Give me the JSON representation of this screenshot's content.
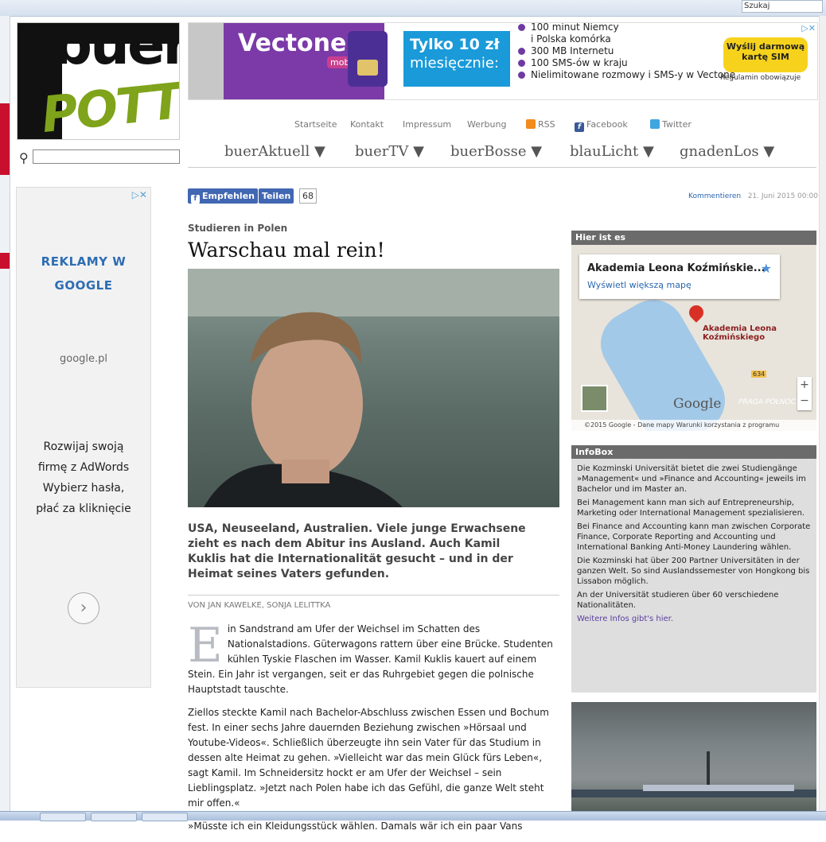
{
  "chrome": {
    "search_placeholder": "Szukaj"
  },
  "site": {
    "search_placeholder": "",
    "logo_top": "buer",
    "logo_bottom": "POTT"
  },
  "banner_ad": {
    "brand": "Vectone",
    "brand_sub": "mobile",
    "price_line1": "Tylko 10 zł",
    "price_line2": "miesięcznie:",
    "bullets": [
      "100 minut Niemcy",
      "i Polska komórka",
      "300 MB Internetu",
      "100 SMS-ów w kraju",
      "Nielimitowane rozmowy i SMS-y w Vectone"
    ],
    "cta": "Wyślij darmową kartę SIM",
    "note": "Regulamin obowiązuje",
    "brand_color": "#7b3aa8",
    "cta_color": "#f7d21c"
  },
  "utility_nav": [
    "Startseite",
    "Kontakt",
    "Impressum",
    "Werbung",
    "RSS",
    "Facebook",
    "Twitter"
  ],
  "main_nav": [
    "buerAktuell ▼",
    "buerTV ▼",
    "buerBosse ▼",
    "blauLicht ▼",
    "gnadenLos ▼"
  ],
  "share": {
    "like": "Empfehlen",
    "share": "Teilen",
    "count": "68",
    "comments": "Kommentieren",
    "date": "21. Juni 2015  00:00"
  },
  "left_ad": {
    "title_line1": "REKLAMY W",
    "title_line2": "GOOGLE",
    "domain": "google.pl",
    "copy_lines": [
      "Rozwijaj swoją",
      "firmę z AdWords",
      "Wybierz hasła,",
      "płać za kliknięcie"
    ],
    "arrow": "›"
  },
  "article": {
    "kicker": "Studieren in Polen",
    "headline": "Warschau mal rein!",
    "lead": "USA, Neuseeland, Australien. Viele junge Erwachsene zieht es nach dem Abitur ins Ausland. Auch Kamil Kuklis hat die Internationalität gesucht – und in der Heimat seines Vaters gefunden.",
    "byline": "VON JAN KAWELKE, SONJA LELITTKA",
    "dropcap": "E",
    "p1": "in Sandstrand am Ufer der Weichsel im Schatten des Nationalstadions. Güterwagons rattern über eine Brücke. Studenten kühlen Tyskie Flaschen im Wasser. Kamil Kuklis kauert auf einem Stein. Ein Jahr ist vergangen, seit er das Ruhrgebiet gegen die polnische Hauptstadt tauschte.",
    "p2": "Ziellos steckte Kamil nach Bachelor-Abschluss zwischen Essen und Bochum fest. In einer sechs Jahre dauernden Beziehung zwischen »Hörsaal und Youtube-Videos«. Schließlich überzeugte ihn sein Vater für das Studium in dessen alte Heimat zu gehen. »Vielleicht war das mein Glück fürs Leben«, sagt Kamil. Im Schneidersitz hockt er am Ufer der Weichsel – sein Lieblingsplatz. »Jetzt nach Polen habe ich das Gefühl, die ganze Welt steht mir offen.«",
    "p3": "»Müsste ich ein Kleidungsstück wählen. Damals wär ich ein paar Vans"
  },
  "sidebar": {
    "map_heading": "Hier ist es",
    "map_place": "Akademia Leona Koźmińskie...",
    "map_link": "Wyświetl większą mapę",
    "map_pin_label_1": "Akademia Leona",
    "map_pin_label_2": "Koźmińskiego",
    "map_road": "634",
    "map_district": "PRAGA-PÓŁNOC",
    "map_logo": "Google",
    "map_footer": "©2015 Google - Dane mapy   Warunki korzystania z programu",
    "info_heading": "InfoBox",
    "info_paragraphs": [
      "Die Kozminski Universität bietet die zwei Studiengänge »Management« und »Finance and Accounting« jeweils im Bachelor und im Master an.",
      "Bei Management kann man sich auf Entrepreneurship, Marketing oder International Management spezialisieren.",
      "Bei Finance and Accounting kann man zwischen Corporate Finance, Corporate Reporting and Accounting und International Banking Anti-Money Laundering wählen.",
      "Die Kozminski hat über 200 Partner Universitäten in der ganzen Welt. So sind Auslandssemester von Hongkong bis Lissabon möglich.",
      "An der Universität studieren über 60 verschiedene Nationalitäten."
    ],
    "info_link": "Weitere Infos gibt's hier."
  }
}
